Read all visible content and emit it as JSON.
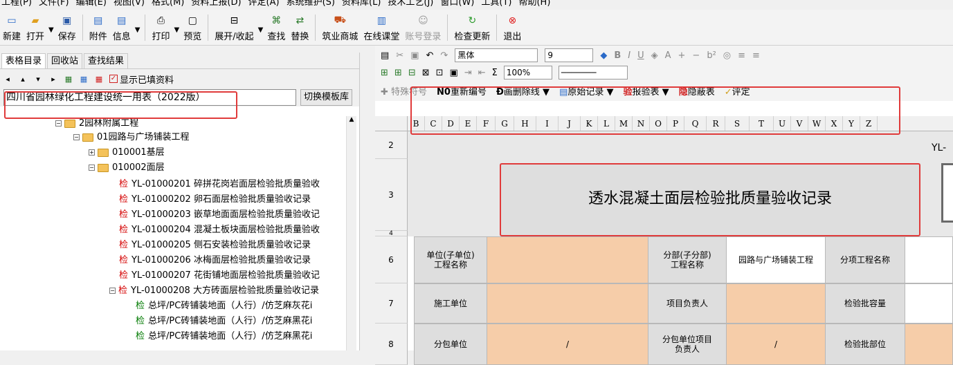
{
  "menu": [
    "工程(P)",
    "文件(F)",
    "编辑(E)",
    "视图(V)",
    "格式(M)",
    "资料上报(D)",
    "评定(A)",
    "系统维护(S)",
    "资料库(L)",
    "技术工艺(J)",
    "窗口(W)",
    "工具(T)",
    "帮助(H)"
  ],
  "toolbar": {
    "new": "新建",
    "open": "打开",
    "save": "保存",
    "attach": "附件",
    "info": "信息",
    "print": "打印",
    "preview": "预览",
    "expand": "展开/收起",
    "find": "查找",
    "replace": "替换",
    "mall": "筑业商城",
    "course": "在线课堂",
    "login": "账号登录",
    "update": "检查更新",
    "exit": "退出"
  },
  "left": {
    "tabs": [
      "表格目录",
      "回收站",
      "查找结果"
    ],
    "show_filled": "显示已填资料",
    "template": "四川省园林绿化工程建设统一用表（2022版）",
    "switch": "切换模板库"
  },
  "tree": [
    {
      "label": "2园林附属工程",
      "type": "folder"
    },
    {
      "label": "01园路与广场铺装工程",
      "type": "folder"
    },
    {
      "label": "010001基层",
      "type": "folder"
    },
    {
      "label": "010002面层",
      "type": "folder"
    },
    {
      "chk": "检",
      "label": "YL-01000201 碎拼花岗岩面层检验批质量验收"
    },
    {
      "chk": "检",
      "label": "YL-01000202 卵石面层检验批质量验收记录"
    },
    {
      "chk": "检",
      "label": "YL-01000203 嵌草地面面层检验批质量验收记"
    },
    {
      "chk": "检",
      "label": "YL-01000204 混凝土板块面层检验批质量验收"
    },
    {
      "chk": "检",
      "label": "YL-01000205 侧石安装检验批质量验收记录"
    },
    {
      "chk": "检",
      "label": "YL-01000206 冰梅面层检验批质量验收记录"
    },
    {
      "chk": "检",
      "label": "YL-01000207 花街铺地面层检验批质量验收记"
    },
    {
      "chk": "检",
      "label": "YL-01000208 大方砖面层检验批质量验收记录"
    },
    {
      "chk": "检",
      "label": "总坪/PC砖铺装地面（人行）/仿芝麻灰花i"
    },
    {
      "chk": "检",
      "label": "总坪/PC砖铺装地面（人行）/仿芝麻黑花i"
    },
    {
      "chk": "检",
      "label": "总坪/PC砖铺装地面（人行）/仿芝麻黑花i"
    }
  ],
  "format": {
    "font": "黑体",
    "size": "9",
    "zoom": "100%"
  },
  "special": {
    "special_char": "特殊符号",
    "renumber": "重新编号",
    "strike": "画删除线",
    "original": "原始记录",
    "report": "报验表",
    "hide": "隐蔽表",
    "evaluate": "评定"
  },
  "columns": [
    "B",
    "C",
    "D",
    "E",
    "F",
    "G",
    "H",
    "I",
    "J",
    "K",
    "L",
    "M",
    "N",
    "O",
    "P",
    "Q",
    "R",
    "S",
    "T",
    "U",
    "V",
    "W",
    "X",
    "Y",
    "Z"
  ],
  "rows": [
    "2",
    "3",
    "4",
    "6",
    "7",
    "8"
  ],
  "sheet": {
    "code": "YL-",
    "title": "透水混凝土面层检验批质量验收记录",
    "unit_label": "单位(子单位)\n工程名称",
    "part_label": "分部(子分部)\n工程名称",
    "part_value": "园路与广场铺装工程",
    "item_label": "分项工程名称",
    "constructor": "施工单位",
    "pm": "项目负责人",
    "capacity": "检验批容量",
    "sub_unit": "分包单位",
    "slash1": "/",
    "sub_pm": "分包单位项目\n负责人",
    "slash2": "/",
    "location": "检验批部位"
  }
}
